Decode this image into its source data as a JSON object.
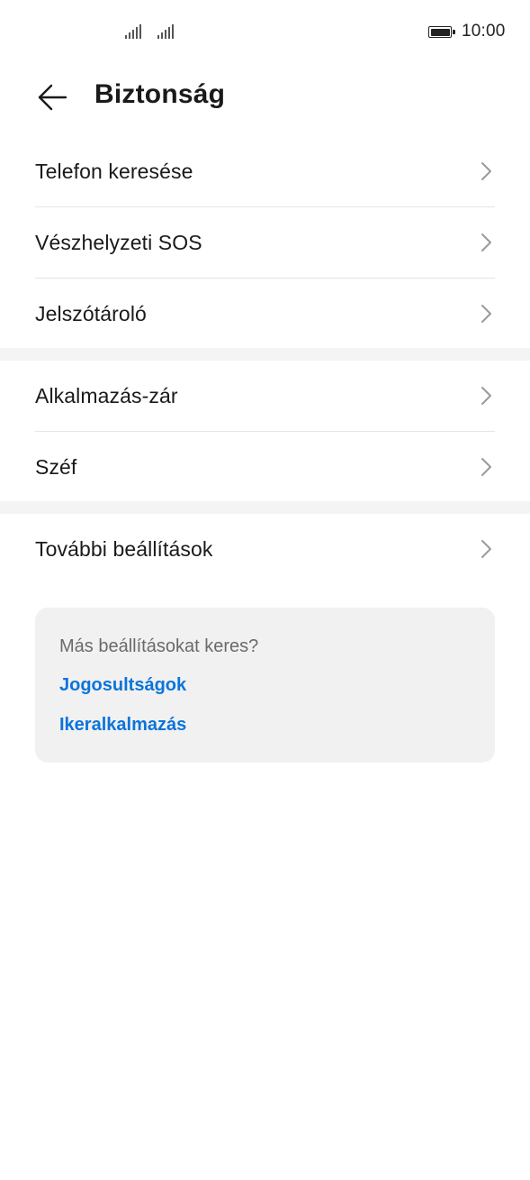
{
  "status_bar": {
    "time": "10:00",
    "icons": [
      "signal-icon",
      "signal-icon",
      "battery-icon"
    ]
  },
  "header": {
    "back_icon": "arrow-left-icon",
    "title": "Biztonság"
  },
  "groups": [
    {
      "items": [
        {
          "label": "Telefon keresése",
          "icon": "chevron-right-icon"
        },
        {
          "label": "Vészhelyzeti SOS",
          "icon": "chevron-right-icon"
        },
        {
          "label": "Jelszótároló",
          "icon": "chevron-right-icon"
        }
      ]
    },
    {
      "items": [
        {
          "label": "Alkalmazás-zár",
          "icon": "chevron-right-icon"
        },
        {
          "label": "Széf",
          "icon": "chevron-right-icon"
        }
      ]
    },
    {
      "items": [
        {
          "label": "További beállítások",
          "icon": "chevron-right-icon"
        }
      ]
    }
  ],
  "suggestions": {
    "question": "Más beállításokat keres?",
    "links": [
      "Jogosultságok",
      "Ikeralkalmazás"
    ]
  },
  "colors": {
    "accent": "#0a74db",
    "separator": "#f4f4f4",
    "card_bg": "#f1f1f1"
  }
}
